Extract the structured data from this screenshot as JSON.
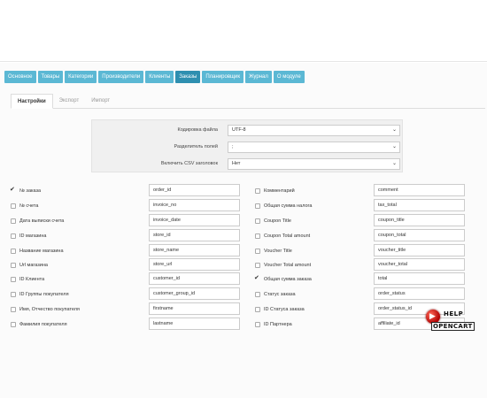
{
  "main_tabs": [
    "Основное",
    "Товары",
    "Категории",
    "Производители",
    "Клиенты",
    "Заказы",
    "Планировщик",
    "Журнал",
    "О модуле"
  ],
  "sub_tabs": [
    "Настройки",
    "Экспорт",
    "Импорт"
  ],
  "settings": [
    {
      "label": "Кодировка файла",
      "value": "UTF-8"
    },
    {
      "label": "Разделитель полей",
      "value": ";"
    },
    {
      "label": "Включить CSV заголовок",
      "value": "Нет"
    }
  ],
  "fields_left": [
    {
      "label": "№ заказа",
      "value": "order_id",
      "checked": true
    },
    {
      "label": "№ счета",
      "value": "invoice_no",
      "checked": false
    },
    {
      "label": "Дата выписки счета",
      "value": "invoice_date",
      "checked": false
    },
    {
      "label": "ID магазина",
      "value": "store_id",
      "checked": false
    },
    {
      "label": "Название магазина",
      "value": "store_name",
      "checked": false
    },
    {
      "label": "Url магазина",
      "value": "store_url",
      "checked": false
    },
    {
      "label": "ID Клиента",
      "value": "customer_id",
      "checked": false
    },
    {
      "label": "ID Группы покупателя",
      "value": "customer_group_id",
      "checked": false
    },
    {
      "label": "Имя, Отчество покупателя",
      "value": "firstname",
      "checked": false
    },
    {
      "label": "Фамилия покупателя",
      "value": "lastname",
      "checked": false
    }
  ],
  "fields_right": [
    {
      "label": "Комментарий",
      "value": "comment",
      "checked": false
    },
    {
      "label": "Общая сумма налога",
      "value": "tax_total",
      "checked": false
    },
    {
      "label": "Coupon Title",
      "value": "coupon_title",
      "checked": false
    },
    {
      "label": "Coupon Total amount",
      "value": "coupon_total",
      "checked": false
    },
    {
      "label": "Voucher Title",
      "value": "voucher_title",
      "checked": false
    },
    {
      "label": "Voucher Total amount",
      "value": "voucher_total",
      "checked": false
    },
    {
      "label": "Общая сумма заказа",
      "value": "total",
      "checked": true
    },
    {
      "label": "Статус заказа",
      "value": "order_status",
      "checked": false
    },
    {
      "label": "ID Статуса заказа",
      "value": "order_status_id",
      "checked": false
    },
    {
      "label": "ID Партнера",
      "value": "affiliate_id",
      "checked": false
    }
  ],
  "logo": {
    "line1": "HELP",
    "line2": "OPENCART"
  },
  "colors": {
    "tab": "#5bb8d4",
    "tab_active": "#2e8fb0"
  }
}
